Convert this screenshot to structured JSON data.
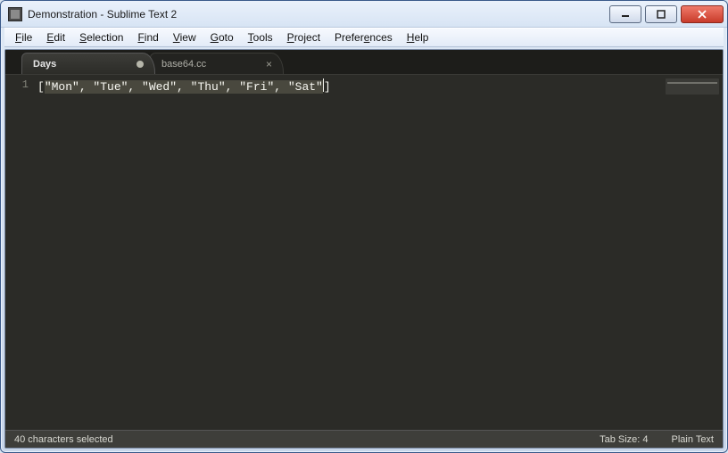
{
  "window": {
    "title": "Demonstration - Sublime Text 2"
  },
  "menubar": [
    {
      "label": "File",
      "hotkey_index": 0
    },
    {
      "label": "Edit",
      "hotkey_index": 0
    },
    {
      "label": "Selection",
      "hotkey_index": 0
    },
    {
      "label": "Find",
      "hotkey_index": 0
    },
    {
      "label": "View",
      "hotkey_index": 0
    },
    {
      "label": "Goto",
      "hotkey_index": 0
    },
    {
      "label": "Tools",
      "hotkey_index": 0
    },
    {
      "label": "Project",
      "hotkey_index": 0
    },
    {
      "label": "Preferences",
      "hotkey_index": 6
    },
    {
      "label": "Help",
      "hotkey_index": 0
    }
  ],
  "tabs": [
    {
      "label": "Days",
      "dirty": true,
      "active": true,
      "closeable": false
    },
    {
      "label": "base64.cc",
      "dirty": false,
      "active": false,
      "closeable": true
    }
  ],
  "editor": {
    "gutter_line": "1",
    "line_prefix": "[",
    "line_selected": "\"Mon\", \"Tue\", \"Wed\", \"Thu\", \"Fri\", \"Sat\"",
    "line_suffix": "]"
  },
  "status": {
    "left": "40 characters selected",
    "tab_size": "Tab Size: 4",
    "syntax": "Plain Text"
  }
}
